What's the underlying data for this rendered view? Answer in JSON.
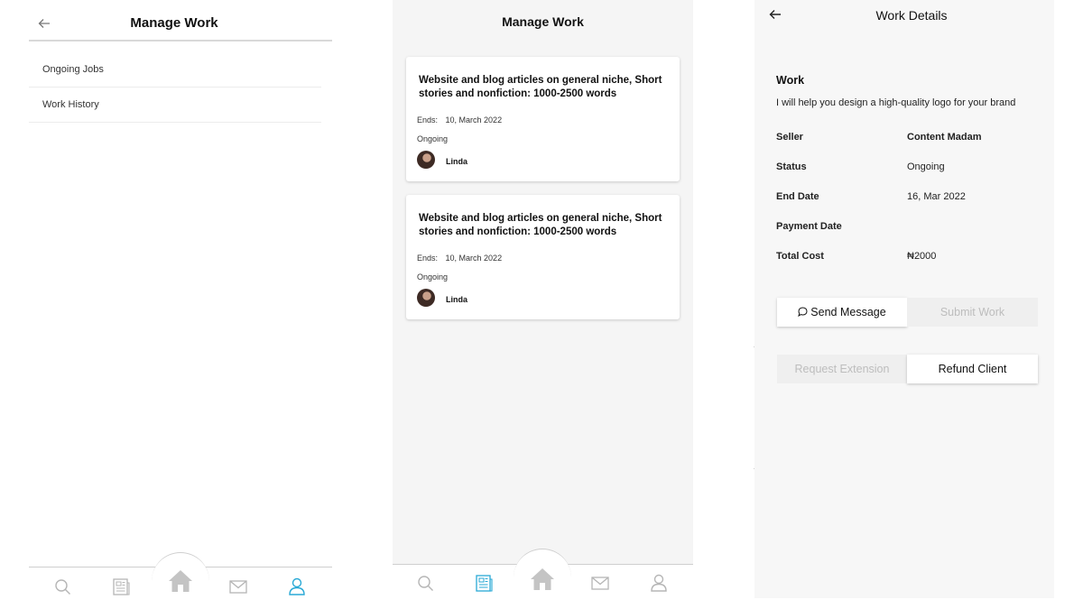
{
  "screen1": {
    "title": "Manage Work",
    "back_icon": "arrow-left-icon",
    "menu": [
      {
        "label": "Ongoing Jobs"
      },
      {
        "label": "Work History"
      }
    ]
  },
  "screen2": {
    "title": "Manage Work",
    "cards": [
      {
        "title": "Website and blog articles on general niche, Short stories and nonfiction: 1000-2500 words",
        "ends_label": "Ends:",
        "ends_date": "10, March 2022",
        "status": "Ongoing",
        "user": "Linda"
      },
      {
        "title": "Website and blog articles on general niche, Short stories and nonfiction: 1000-2500 words",
        "ends_label": "Ends:",
        "ends_date": "10, March 2022",
        "status": "Ongoing",
        "user": "Linda"
      }
    ]
  },
  "screen3": {
    "title": "Work Details",
    "back_icon": "arrow-left-icon",
    "work_label": "Work",
    "work_description": "I will help you design a high-quality logo for your brand",
    "details": [
      {
        "label": "Seller",
        "value": "Content Madam"
      },
      {
        "label": "Status",
        "value": "Ongoing"
      },
      {
        "label": "End Date",
        "value": "16, Mar 2022"
      },
      {
        "label": "Payment Date",
        "value": ""
      },
      {
        "label": "Total Cost",
        "value": "₦2000"
      }
    ],
    "buttons": {
      "send_message": "Send Message",
      "submit_work": "Submit Work",
      "request_extension": "Request Extension",
      "refund_client": "Refund Client"
    }
  },
  "bottom_nav": {
    "items": [
      "search-icon",
      "newspaper-icon",
      "home-icon",
      "mail-icon",
      "user-icon"
    ],
    "active_screen1": "user-icon",
    "active_screen2": "newspaper-icon"
  },
  "colors": {
    "active": "#29a9d6",
    "inactive": "#b5b5b5",
    "home": "#c4c4c4"
  }
}
